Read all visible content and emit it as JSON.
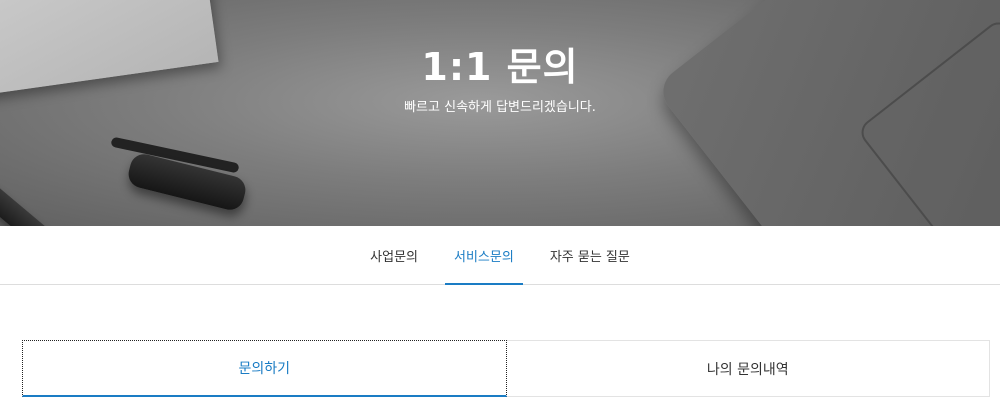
{
  "hero": {
    "title": "1:1 문의",
    "subtitle": "빠르고 신속하게 답변드리겠습니다."
  },
  "tabs": [
    {
      "label": "사업문의",
      "active": false
    },
    {
      "label": "서비스문의",
      "active": true
    },
    {
      "label": "자주 묻는 질문",
      "active": false
    }
  ],
  "subtabs": [
    {
      "label": "문의하기",
      "active": true
    },
    {
      "label": "나의 문의내역",
      "active": false
    }
  ],
  "colors": {
    "accent": "#1a7cc4",
    "text": "#333333",
    "border": "#dddddd"
  }
}
